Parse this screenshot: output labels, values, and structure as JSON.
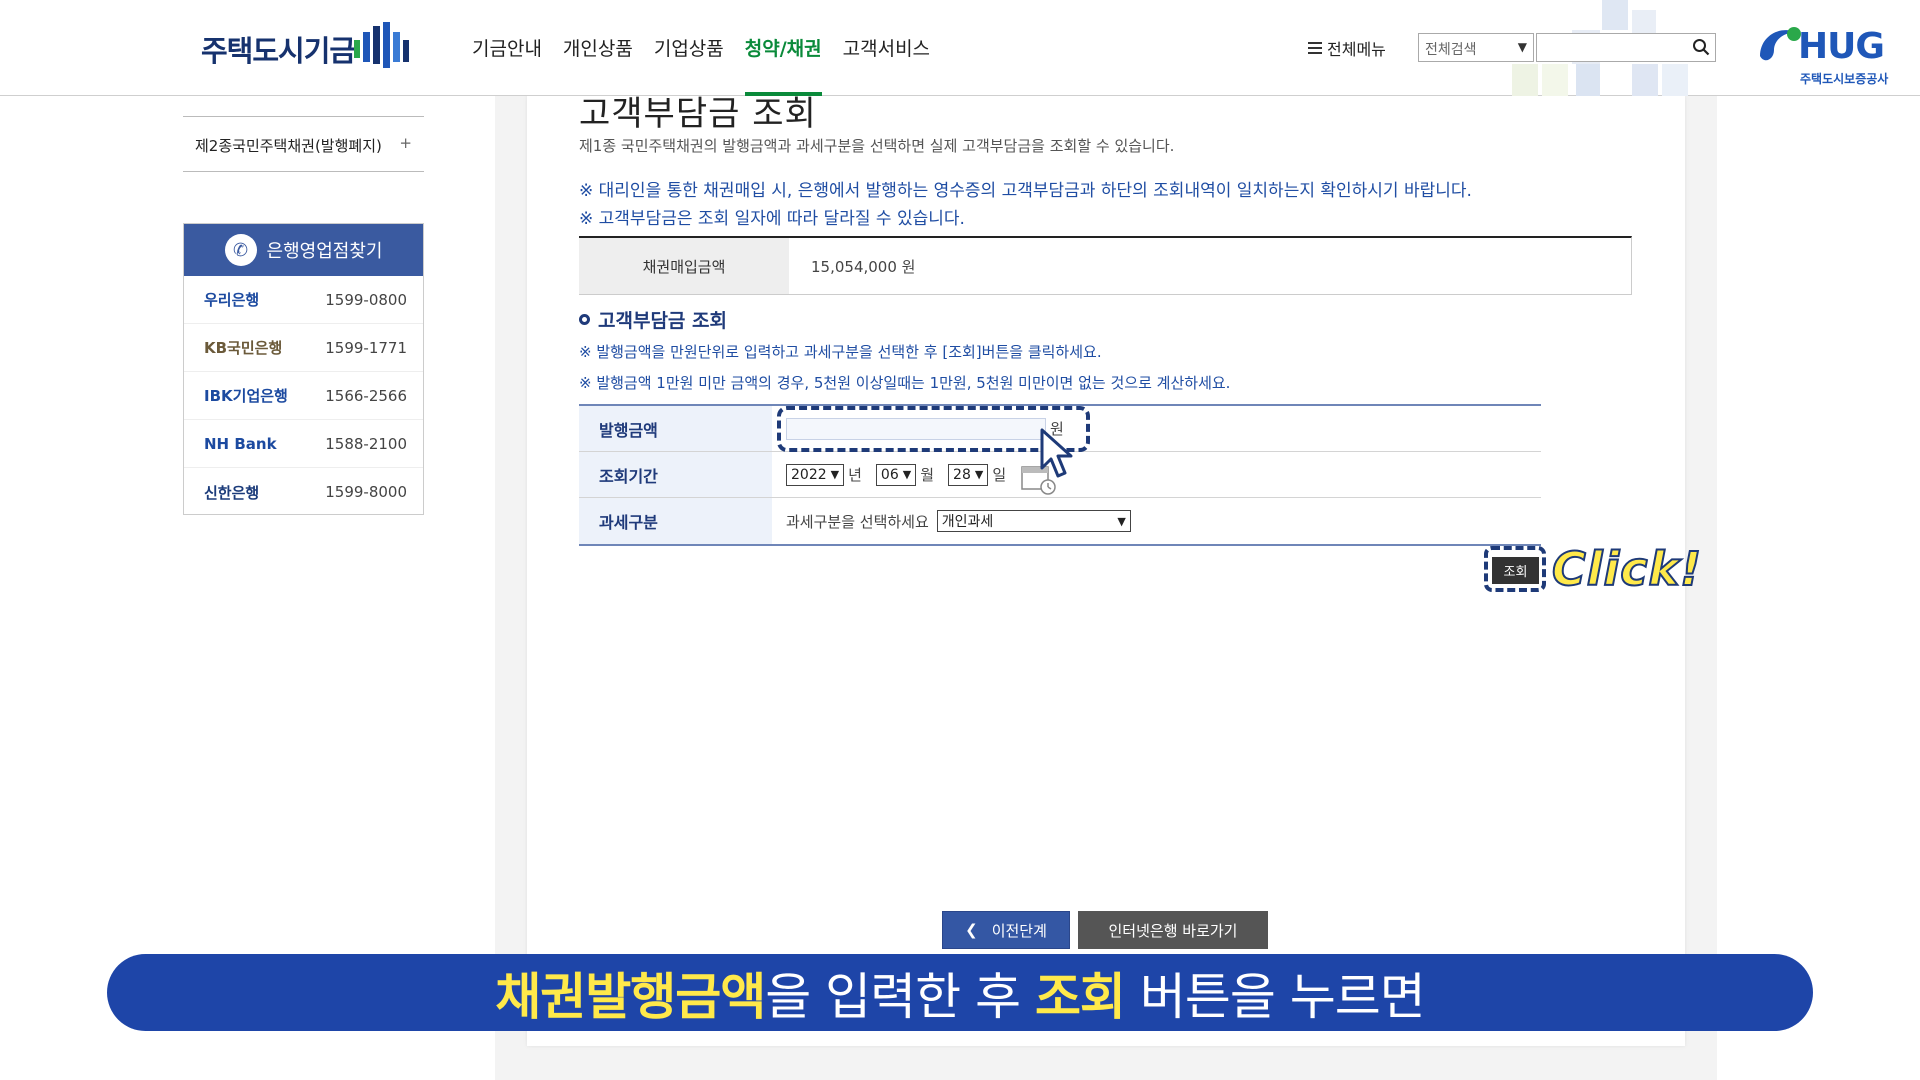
{
  "header": {
    "logo_text": "주택도시기금",
    "nav": [
      "기금안내",
      "개인상품",
      "기업상품",
      "청약/채권",
      "고객서비스"
    ],
    "active_nav": "청약/채권",
    "all_menu_label": "전체메뉴",
    "search_scope": "전체검색",
    "search_value": "",
    "hug_logo": "HUG",
    "hug_sub": "주택도시보증공사"
  },
  "sidebar": {
    "sub_item": "제2종국민주택채권(발행폐지)",
    "sub_plus": "+",
    "bank_title": "은행영업점찾기",
    "banks": [
      {
        "name": "우리은행",
        "tel": "1599-0800"
      },
      {
        "name": "KB국민은행",
        "tel": "1599-1771"
      },
      {
        "name": "IBK기업은행",
        "tel": "1566-2566"
      },
      {
        "name": "NH Bank",
        "tel": "1588-2100"
      },
      {
        "name": "신한은행",
        "tel": "1599-8000"
      }
    ]
  },
  "main": {
    "title": "고객부담금 조회",
    "description": "제1종 국민주택채권의 발행금액과 과세구분을 선택하면 실제 고객부담금을 조회할 수 있습니다.",
    "notes": [
      "※ 대리인을 통한 채권매입 시, 은행에서 발행하는 영수증의 고객부담금과 하단의 조회내역이 일치하는지 확인하시기 바랍니다.",
      "※ 고객부담금은 조회 일자에 따라 달라질 수 있습니다."
    ],
    "summary_label": "채권매입금액",
    "summary_value": "15,054,000 원",
    "section_title": "고객부담금 조회",
    "section_notes": [
      "※ 발행금액을 만원단위로 입력하고 과세구분을 선택한 후 [조회]버튼을 클릭하세요.",
      "※ 발행금액 1만원 미만 금액의 경우, 5천원 이상일때는 1만원, 5천원 미만이면 없는 것으로 계산하세요."
    ],
    "form": {
      "amount_label": "발행금액",
      "amount_value": "",
      "amount_unit": "원",
      "period_label": "조회기간",
      "year": "2022",
      "year_unit": "년",
      "month": "06",
      "month_unit": "월",
      "day": "28",
      "day_unit": "일",
      "tax_label": "과세구분",
      "tax_prompt": "과세구분을 선택하세요",
      "tax_selected": "개인과세"
    },
    "lookup_label": "조회",
    "click_label": "Click!",
    "prev_label": "이전단계",
    "internet_bank_label": "인터넷은행 바로가기"
  },
  "caption": {
    "part1": "채권발행금액",
    "part2": "을 입력한 후 ",
    "part3": "조회",
    "part4": " 버튼을 누르면"
  },
  "colors": {
    "accent": "#1e45a8",
    "active_nav": "#0a8a3a",
    "highlight": "#ffe94a"
  }
}
